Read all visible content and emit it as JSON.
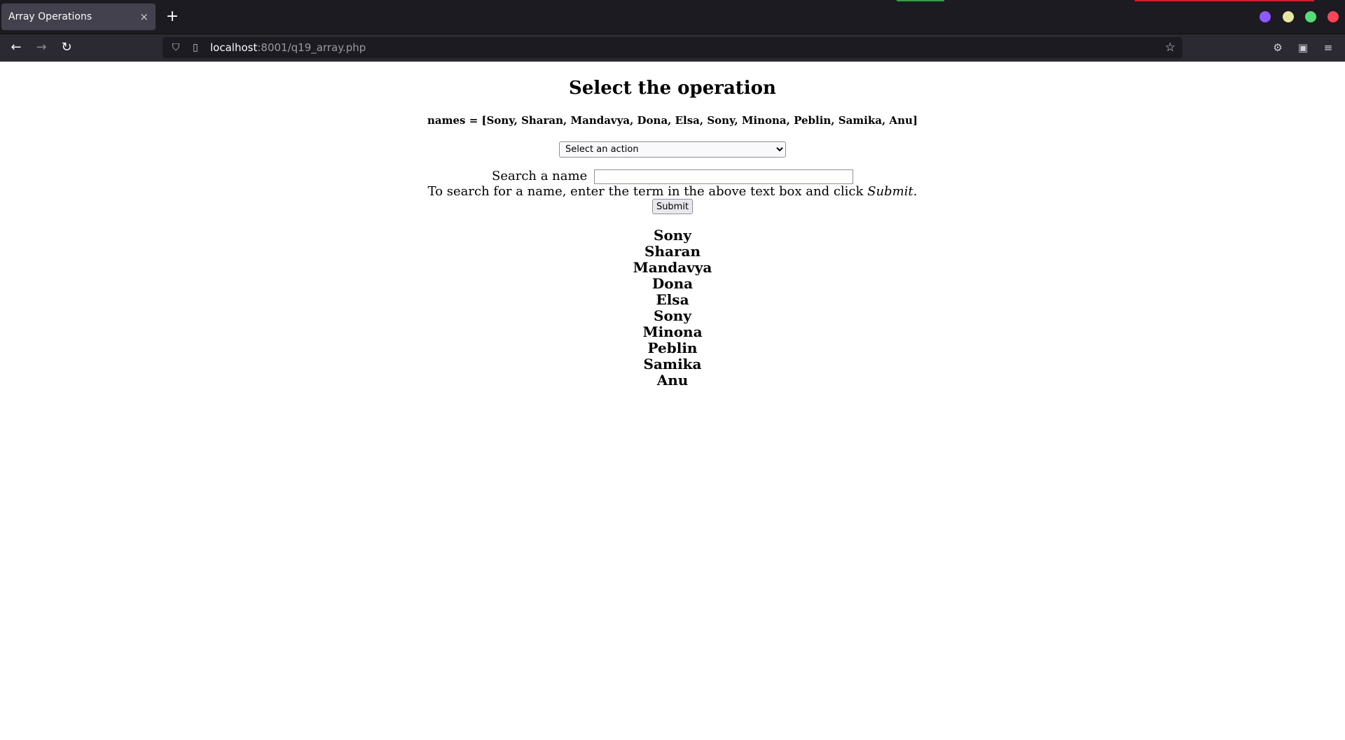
{
  "browser": {
    "tab_title": "Array Operations",
    "tab_close": "×",
    "new_tab": "+",
    "url_host": "localhost",
    "url_rest": ":8001/q19_array.php",
    "colors": {
      "chrome_bg": "#1c1b22",
      "tab_bg": "#42414d",
      "win_purple": "#9059ff",
      "win_yellow": "#e6e6a0",
      "win_green": "#55dd77",
      "win_red": "#ff4455",
      "accent_green": "#2ea043",
      "accent_red": "#e0182b"
    }
  },
  "page": {
    "title": "Select the operation",
    "array_text": "names = [Sony, Sharan, Mandavya, Dona, Elsa, Sony, Minona, Peblin, Samika, Anu]",
    "select_value": "Select an action",
    "search_label": "Search a name",
    "search_value": "",
    "hint_pre": "To search for a name, enter the term in the above text box and click ",
    "hint_em": "Submit",
    "hint_post": ".",
    "submit_label": "Submit",
    "names": [
      "Sony",
      "Sharan",
      "Mandavya",
      "Dona",
      "Elsa",
      "Sony",
      "Minona",
      "Peblin",
      "Samika",
      "Anu"
    ]
  }
}
